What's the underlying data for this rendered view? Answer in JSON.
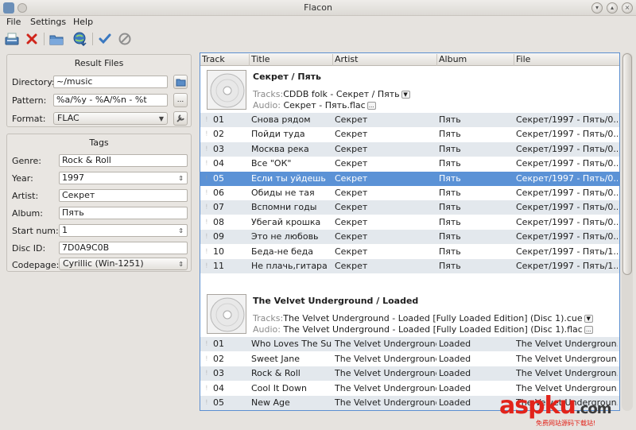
{
  "window": {
    "title": "Flacon"
  },
  "menu": [
    "File",
    "Settings",
    "Help"
  ],
  "toolbar": {
    "icons": [
      "save-icon",
      "remove-icon",
      "open-folder-icon",
      "download-info-icon",
      "convert-check-icon",
      "abort-icon"
    ]
  },
  "result_files": {
    "title": "Result Files",
    "directory_label": "Directory:",
    "directory_value": "~/music",
    "pattern_label": "Pattern:",
    "pattern_value": "%a/%y - %A/%n - %t",
    "pattern_button": "...",
    "format_label": "Format:",
    "format_value": "FLAC"
  },
  "tags": {
    "title": "Tags",
    "genre_label": "Genre:",
    "genre_value": "Rock & Roll",
    "year_label": "Year:",
    "year_value": "1997",
    "artist_label": "Artist:",
    "artist_value": "Секрет",
    "album_label": "Album:",
    "album_value": "Пять",
    "start_num_label": "Start num:",
    "start_num_value": "1",
    "disc_id_label": "Disc ID:",
    "disc_id_value": "7D0A9C0B",
    "codepage_label": "Codepage:",
    "codepage_value": "Cyrillic (Win-1251)"
  },
  "columns": [
    "Track",
    "Title",
    "Artist",
    "Album",
    "File"
  ],
  "discs": [
    {
      "title": "Секрет / Пять",
      "tracks_key": "Tracks:",
      "tracks_value": "CDDB folk - Секрет / Пять",
      "audio_key": "Audio:",
      "audio_value": "Секрет - Пять.flac",
      "audio_button": "...",
      "rows": [
        {
          "track": "01",
          "title": "Снова рядом",
          "artist": "Секрет",
          "album": "Пять",
          "file": "Секрет/1997 - Пять/0..."
        },
        {
          "track": "02",
          "title": "Пойди туда",
          "artist": "Секрет",
          "album": "Пять",
          "file": "Секрет/1997 - Пять/0..."
        },
        {
          "track": "03",
          "title": "Москва река",
          "artist": "Секрет",
          "album": "Пять",
          "file": "Секрет/1997 - Пять/0..."
        },
        {
          "track": "04",
          "title": "Все \"ОК\"",
          "artist": "Секрет",
          "album": "Пять",
          "file": "Секрет/1997 - Пять/0..."
        },
        {
          "track": "05",
          "title": "Если ты уйдешь",
          "artist": "Секрет",
          "album": "Пять",
          "file": "Секрет/1997 - Пять/0..."
        },
        {
          "track": "06",
          "title": "Обиды не тая",
          "artist": "Секрет",
          "album": "Пять",
          "file": "Секрет/1997 - Пять/0..."
        },
        {
          "track": "07",
          "title": "Вспомни годы",
          "artist": "Секрет",
          "album": "Пять",
          "file": "Секрет/1997 - Пять/0..."
        },
        {
          "track": "08",
          "title": "Убегай крошка",
          "artist": "Секрет",
          "album": "Пять",
          "file": "Секрет/1997 - Пять/0..."
        },
        {
          "track": "09",
          "title": "Это не любовь",
          "artist": "Секрет",
          "album": "Пять",
          "file": "Секрет/1997 - Пять/0..."
        },
        {
          "track": "10",
          "title": "Беда-не беда",
          "artist": "Секрет",
          "album": "Пять",
          "file": "Секрет/1997 - Пять/1..."
        },
        {
          "track": "11",
          "title": "Не плачь,гитара",
          "artist": "Секрет",
          "album": "Пять",
          "file": "Секрет/1997 - Пять/1..."
        }
      ]
    },
    {
      "title": "The Velvet Underground / Loaded",
      "tracks_key": "Tracks:",
      "tracks_value": "The Velvet Underground - Loaded  [Fully Loaded Edition] (Disc 1).cue",
      "audio_key": "Audio:",
      "audio_value": "The Velvet Underground - Loaded  [Fully Loaded Edition] (Disc 1).flac",
      "audio_button": "...",
      "rows": [
        {
          "track": "01",
          "title": "Who Loves The Sun",
          "artist": "The Velvet Underground",
          "album": "Loaded",
          "file": "The Velvet Undergroun..."
        },
        {
          "track": "02",
          "title": "Sweet Jane",
          "artist": "The Velvet Underground",
          "album": "Loaded",
          "file": "The Velvet Undergroun..."
        },
        {
          "track": "03",
          "title": "Rock & Roll",
          "artist": "The Velvet Underground",
          "album": "Loaded",
          "file": "The Velvet Undergroun..."
        },
        {
          "track": "04",
          "title": "Cool It Down",
          "artist": "The Velvet Underground",
          "album": "Loaded",
          "file": "The Velvet Undergroun..."
        },
        {
          "track": "05",
          "title": "New Age",
          "artist": "The Velvet Underground",
          "album": "Loaded",
          "file": "The Velvet Undergroun..."
        }
      ]
    }
  ],
  "selected_row": {
    "disc": 0,
    "row": 4
  },
  "watermark": {
    "logo_text": "aspku",
    "logo_suffix": ".com",
    "tagline": "免费网站源码下载站!"
  },
  "colors": {
    "selection": "#5b92d6",
    "alt_row": "#e3e8ed",
    "focus_border": "#5c8fd0",
    "watermark_red": "#e2231a"
  }
}
